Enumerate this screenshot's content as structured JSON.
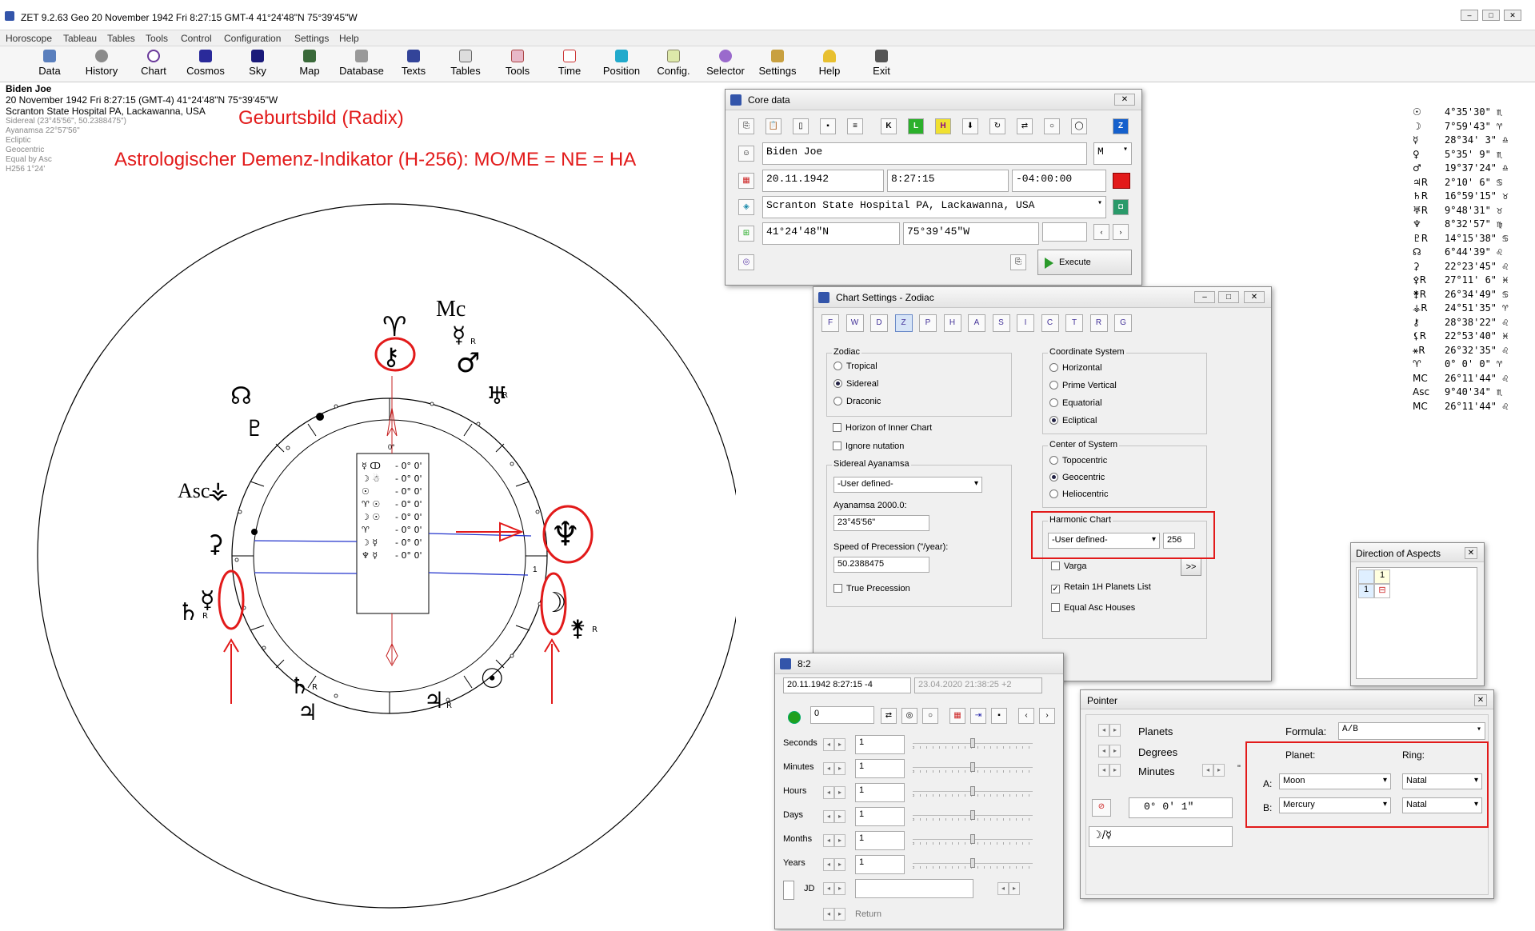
{
  "window": {
    "title": "ZET 9.2.63 Geo   20 November 1942   Fri   8:27:15 GMT-4 41°24'48\"N   75°39'45\"W",
    "controls": [
      "–",
      "□",
      "✕"
    ]
  },
  "menu": [
    "Horoscope",
    "Tableau",
    "Tables",
    "Tools",
    "Control",
    "Configuration",
    "Settings",
    "Help"
  ],
  "toolbar": [
    "Data",
    "History",
    "Chart",
    "Cosmos",
    "Sky",
    "Map",
    "Database",
    "Texts",
    "Tables",
    "Tools",
    "Time",
    "Position",
    "Config.",
    "Selector",
    "Settings",
    "Help",
    "Exit"
  ],
  "chart_header": {
    "name": "Biden Joe",
    "datetime": "20 November 1942   Fri    8:27:15 (GMT-4)  41°24'48\"N   75°39'45\"W",
    "place": "Scranton State Hospital PA, Lackawanna, USA",
    "details": [
      "Sidereal (23°45'56\", 50.2388475\")",
      "Ayanamsa 22°57'56\"",
      "Ecliptic",
      "Geocentric",
      "Equal by Asc",
      "H256   1°24'"
    ]
  },
  "annotations": {
    "title": "Geburtsbild (Radix)",
    "subtitle": "Astrologischer Demenz-Indikator (H-256): MO/ME = NE = HA"
  },
  "wheel": {
    "mc_label": "Mc",
    "asc_label": "Asc",
    "zero_label": "0°",
    "one_label": "1",
    "retro": "R",
    "aspect_box": [
      {
        "g": "☿ ↀ",
        "v": "- 0° 0'"
      },
      {
        "g": "☽ ☃",
        "v": "- 0° 0'"
      },
      {
        "g": "☉",
        "v": "- 0° 0'"
      },
      {
        "g": "♈ ☉",
        "v": "- 0° 0'"
      },
      {
        "g": "☽ ☉",
        "v": "- 0° 0'"
      },
      {
        "g": "♈",
        "v": "- 0° 0'"
      },
      {
        "g": "☽ ☿",
        "v": "- 0° 0'"
      },
      {
        "g": "♆ ☿",
        "v": "- 0° 0'"
      }
    ]
  },
  "planet_list": [
    {
      "glyph": "☉",
      "pos": "4°35'30\" ♏"
    },
    {
      "glyph": "☽",
      "pos": "7°59'43\" ♈"
    },
    {
      "glyph": "☿",
      "pos": "28°34' 3\" ♎"
    },
    {
      "glyph": "♀",
      "pos": "5°35' 9\" ♏"
    },
    {
      "glyph": "♂",
      "pos": "19°37'24\" ♎"
    },
    {
      "glyph": "♃R",
      "pos": "2°10' 6\" ♋"
    },
    {
      "glyph": "♄R",
      "pos": "16°59'15\" ♉"
    },
    {
      "glyph": "♅R",
      "pos": "9°48'31\" ♉"
    },
    {
      "glyph": "♆",
      "pos": "8°32'57\" ♍"
    },
    {
      "glyph": "♇R",
      "pos": "14°15'38\" ♋"
    },
    {
      "glyph": "☊",
      "pos": "6°44'39\" ♌"
    },
    {
      "glyph": "⚳",
      "pos": "22°23'45\" ♌"
    },
    {
      "glyph": "⚴R",
      "pos": "27°11' 6\" ♓"
    },
    {
      "glyph": "⚵R",
      "pos": "26°34'49\" ♋"
    },
    {
      "glyph": "⚶R",
      "pos": "24°51'35\" ♈"
    },
    {
      "glyph": "⚷",
      "pos": "28°38'22\" ♌"
    },
    {
      "glyph": "⚸R",
      "pos": "22°53'40\" ♓"
    },
    {
      "glyph": "⚹R",
      "pos": "26°32'35\" ♌"
    },
    {
      "glyph": "♈",
      "pos": "0° 0' 0\" ♈"
    },
    {
      "glyph": "MC",
      "pos": "26°11'44\" ♌"
    },
    {
      "glyph": "Asc",
      "pos": "9°40'34\" ♏"
    },
    {
      "glyph": "MC",
      "pos": "26°11'44\" ♌"
    }
  ],
  "core_data": {
    "title": "Core data",
    "name": "Biden Joe",
    "gender": "M",
    "date": "20.11.1942",
    "time": "8:27:15",
    "offset": "-04:00:00",
    "place": "Scranton State Hospital PA, Lackawanna, USA",
    "lat": "41°24'48\"N",
    "lon": "75°39'45\"W",
    "execute": "Execute",
    "tool_letters": [
      "K",
      "L",
      "H",
      "Z"
    ]
  },
  "chart_settings": {
    "title": "Chart Settings - Zodiac",
    "tabs": [
      "F",
      "W",
      "D",
      "Z",
      "P",
      "H",
      "A",
      "S",
      "I",
      "C",
      "T",
      "R",
      "G"
    ],
    "zodiac_label": "Zodiac",
    "zodiac": [
      "Tropical",
      "Sidereal",
      "Draconic"
    ],
    "zodiac_selected": "Sidereal",
    "horizon_inner": "Horizon of Inner Chart",
    "ignore_nutation": "Ignore nutation",
    "sidereal_label": "Sidereal Ayanamsa",
    "ayanamsa_select": "-User defined-",
    "ayanamsa_2000_label": "Ayanamsa 2000.0:",
    "ayanamsa_2000": "23°45'56\"",
    "precession_label": "Speed of Precession (\"/year):",
    "precession": "50.2388475",
    "true_precession": "True Precession",
    "coord_label": "Coordinate System",
    "coord": [
      "Horizontal",
      "Prime Vertical",
      "Equatorial",
      "Ecliptical"
    ],
    "coord_selected": "Ecliptical",
    "center_label": "Center of System",
    "center": [
      "Topocentric",
      "Geocentric",
      "Heliocentric"
    ],
    "center_selected": "Geocentric",
    "harmonic_label": "Harmonic Chart",
    "harmonic_select": "-User defined-",
    "harmonic_value": "256",
    "varga": "Varga",
    "varga_btn": ">>",
    "retain": "Retain 1H Planets List",
    "equal_asc": "Equal Asc Houses"
  },
  "direction": {
    "title": "Direction of Aspects",
    "header": "1",
    "row": "1"
  },
  "animator": {
    "title": "8:2",
    "start": "20.11.1942   8:27:15  -4",
    "end": "23.04.2020   21:38:25  +2",
    "step_value": "0",
    "rows": [
      {
        "label": "Seconds",
        "value": "1"
      },
      {
        "label": "Minutes",
        "value": "1"
      },
      {
        "label": "Hours",
        "value": "1"
      },
      {
        "label": "Days",
        "value": "1"
      },
      {
        "label": "Months",
        "value": "1"
      },
      {
        "label": "Years",
        "value": "1"
      }
    ],
    "jd_label": "JD",
    "return_label": "Return"
  },
  "pointer": {
    "title": "Pointer",
    "planets": "Planets",
    "degrees": "Degrees",
    "minutes": "Minutes",
    "formula_label": "Formula:",
    "formula": "A/B",
    "planet_col": "Planet:",
    "ring_col": "Ring:",
    "a_label": "A:",
    "b_label": "B:",
    "a_planet": "Moon",
    "a_ring": "Natal",
    "b_planet": "Mercury",
    "b_ring": "Natal",
    "result": "0° 0' 1\"",
    "glyph_formula": "☽/☿",
    "quote_mark": "\""
  },
  "colors": {
    "accent_red": "#e21a1a",
    "aspect_blue": "#2233cc"
  }
}
